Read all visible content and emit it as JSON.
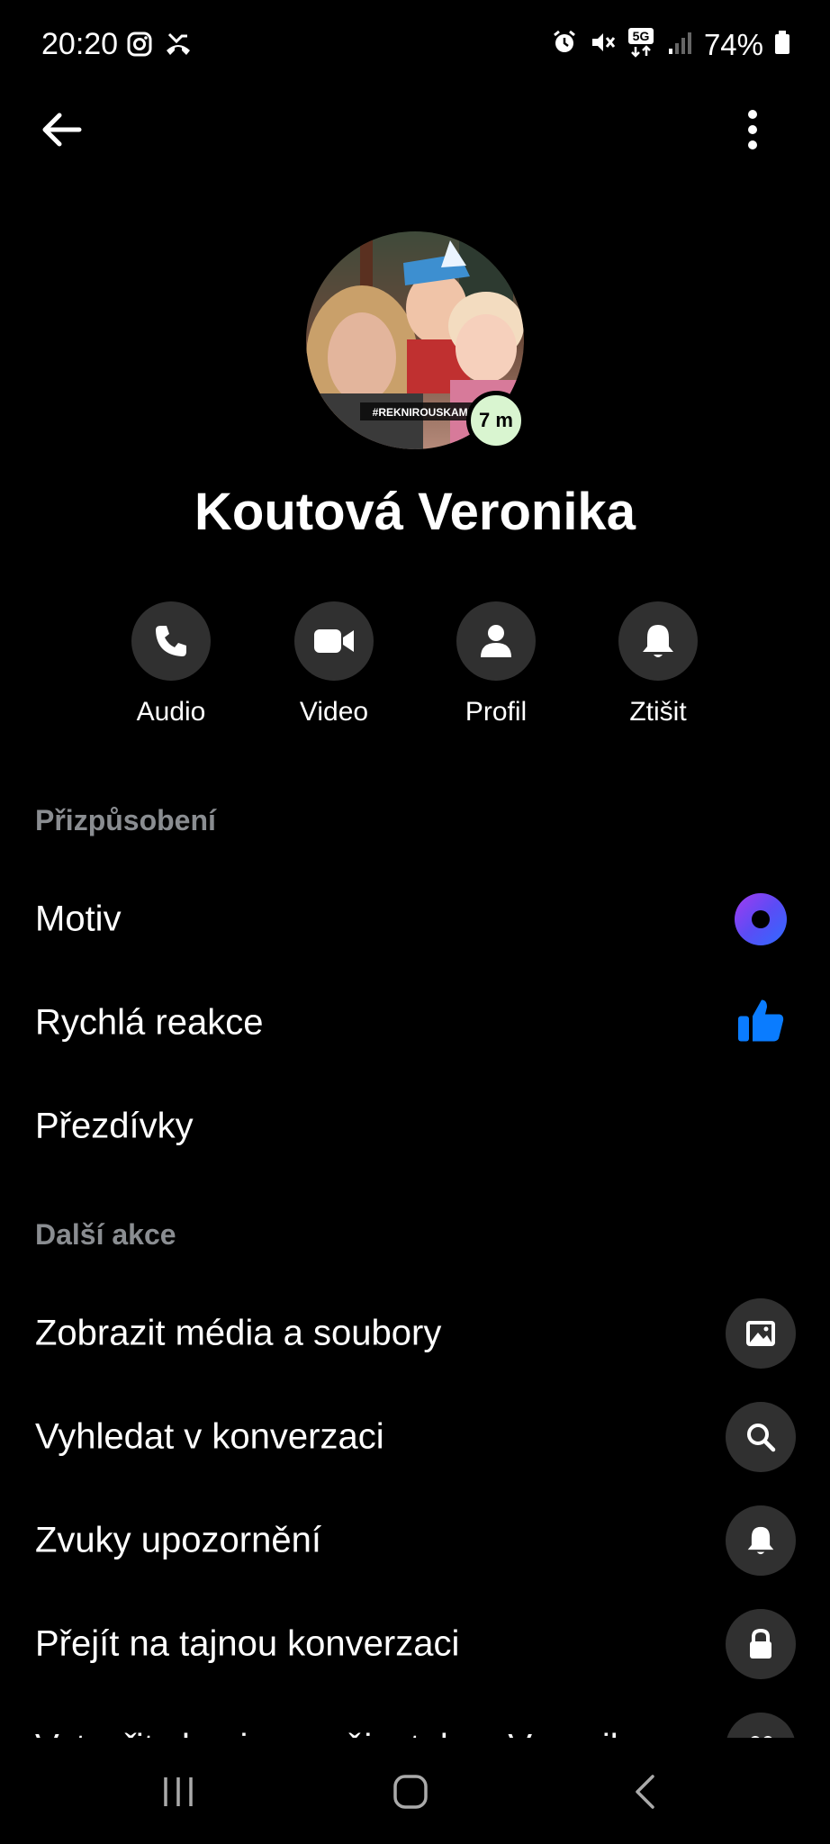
{
  "status_bar": {
    "time": "20:20",
    "battery_percent": "74%",
    "network": "5G",
    "left_icons": [
      "instagram-icon",
      "missed-call-icon"
    ],
    "right_icons": [
      "alarm-icon",
      "mute-icon",
      "5g-icon",
      "signal-icon",
      "battery-icon"
    ]
  },
  "top_bar": {
    "back_icon": "arrow-left-icon",
    "more_icon": "vertical-dots-icon"
  },
  "profile": {
    "name": "Koutová Veronika",
    "active_badge": "7 m",
    "avatar_caption": "#REKNIROUSKAMNE"
  },
  "actions": [
    {
      "label": "Audio",
      "icon": "phone-icon"
    },
    {
      "label": "Video",
      "icon": "video-camera-icon"
    },
    {
      "label": "Profil",
      "icon": "person-icon"
    },
    {
      "label": "Ztišit",
      "icon": "bell-icon"
    }
  ],
  "customization": {
    "title": "Přizpůsobení",
    "items": [
      {
        "label": "Motiv",
        "icon": "theme-dot-icon"
      },
      {
        "label": "Rychlá reakce",
        "icon": "thumbs-up-icon"
      },
      {
        "label": "Přezdívky",
        "icon": ""
      }
    ]
  },
  "more_actions": {
    "title": "Další akce",
    "items": [
      {
        "label": "Zobrazit média a soubory",
        "icon": "image-icon"
      },
      {
        "label": "Vyhledat v konverzaci",
        "icon": "search-icon"
      },
      {
        "label": "Zvuky upozornění",
        "icon": "bell-icon"
      },
      {
        "label": "Přejít na tajnou konverzaci",
        "icon": "lock-icon"
      },
      {
        "label": "Vytvořit skupinu s uživatelem Veronika",
        "icon": "group-icon"
      }
    ]
  },
  "colors": {
    "background": "#000000",
    "button_bg": "#303030",
    "section_title": "#8a8d91",
    "accent_blue": "#0a7cff"
  },
  "nav_bar": {
    "buttons": [
      "recent-apps-icon",
      "home-icon",
      "back-icon"
    ]
  }
}
